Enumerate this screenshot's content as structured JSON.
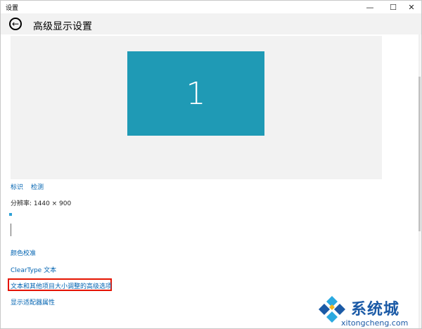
{
  "window": {
    "title": "设置",
    "minimize": "—",
    "maximize": "☐",
    "close": "✕"
  },
  "header": {
    "back_icon": "←",
    "title": "高级显示设置"
  },
  "preview": {
    "monitor_label": "1"
  },
  "links": {
    "identify": "标识",
    "detect": "检测",
    "color_calibration": "颜色校准",
    "cleartype": "ClearType 文本",
    "advanced_sizing": "文本和其他项目大小调整的高级选项",
    "adapter_properties": "显示适配器属性"
  },
  "resolution": {
    "text": "分辨率: 1440 × 900"
  },
  "watermark": {
    "name": "系统城",
    "url": "xitongcheng.com"
  },
  "colors": {
    "accent": "#1f9ab5",
    "link": "#0063b1",
    "highlight": "#e51400",
    "watermark": "#1b5aa6"
  }
}
